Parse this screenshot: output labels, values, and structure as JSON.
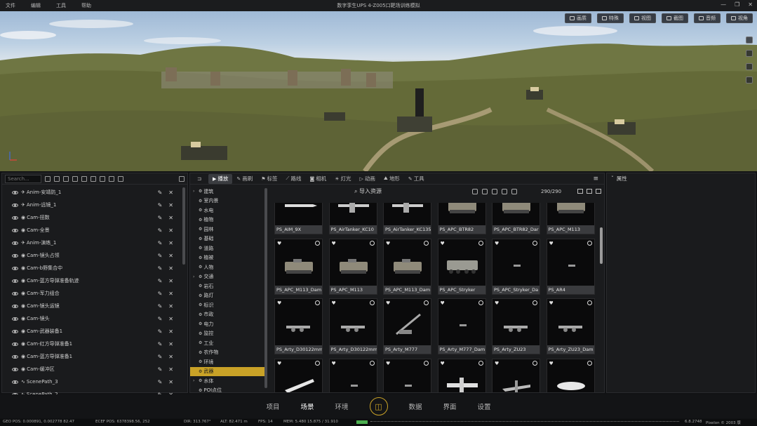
{
  "titlebar": {
    "menu": [
      "文件",
      "编辑",
      "工具",
      "帮助"
    ],
    "title": "数字孪生UPS 4-Z005口靶场训练模拟",
    "controls": [
      "—",
      "❐",
      "✕"
    ]
  },
  "viewport": {
    "toolbar": [
      "画质",
      "特殊",
      "视图",
      "截图",
      "音频",
      "视角"
    ]
  },
  "scene_panel": {
    "search_placeholder": "Search...",
    "items": [
      {
        "icon": "anim",
        "label": "Anim-安靖防_1"
      },
      {
        "icon": "anim",
        "label": "Anim-远镜_1"
      },
      {
        "icon": "cam",
        "label": "Cam-扭数"
      },
      {
        "icon": "cam",
        "label": "Cam-全景"
      },
      {
        "icon": "anim",
        "label": "Anim-演练_1"
      },
      {
        "icon": "cam",
        "label": "Cam-镜头占领"
      },
      {
        "icon": "cam",
        "label": "Cam-b野集合中"
      },
      {
        "icon": "cam",
        "label": "Cam-蓝方导弹准备轨迹"
      },
      {
        "icon": "cam",
        "label": "Cam-军力组合"
      },
      {
        "icon": "cam",
        "label": "Cam-镜头运镜"
      },
      {
        "icon": "cam",
        "label": "Cam-镜头"
      },
      {
        "icon": "cam",
        "label": "Cam-武器装备1"
      },
      {
        "icon": "cam",
        "label": "Cam-红方导弹准备1"
      },
      {
        "icon": "cam",
        "label": "Cam-蓝方导弹准备1"
      },
      {
        "icon": "cam",
        "label": "Cam-缓冲区"
      },
      {
        "icon": "path",
        "label": "ScenePath_3"
      },
      {
        "icon": "path",
        "label": "ScenePath_2"
      }
    ]
  },
  "asset_panel": {
    "tabs": [
      {
        "label": "播放",
        "active": true
      },
      {
        "label": "画刷",
        "active": false
      },
      {
        "label": "标签",
        "active": false
      },
      {
        "label": "路线",
        "active": false
      },
      {
        "label": "相机",
        "active": false
      },
      {
        "label": "灯光",
        "active": false
      },
      {
        "label": "动画",
        "active": false
      },
      {
        "label": "地形",
        "active": false
      },
      {
        "label": "工具",
        "active": false
      }
    ],
    "tree": [
      {
        "label": "建筑",
        "expand": true,
        "selected": false
      },
      {
        "label": "室内景",
        "expand": false,
        "selected": false
      },
      {
        "label": "水电",
        "expand": false,
        "selected": false
      },
      {
        "label": "植物",
        "expand": false,
        "selected": false
      },
      {
        "label": "园林",
        "expand": false,
        "selected": false
      },
      {
        "label": "基础",
        "expand": false,
        "selected": false
      },
      {
        "label": "道路",
        "expand": false,
        "selected": false
      },
      {
        "label": "植被",
        "expand": false,
        "selected": false
      },
      {
        "label": "人物",
        "expand": false,
        "selected": false
      },
      {
        "label": "交通",
        "expand": true,
        "selected": false
      },
      {
        "label": "岩石",
        "expand": false,
        "selected": false
      },
      {
        "label": "路灯",
        "expand": false,
        "selected": false
      },
      {
        "label": "标识",
        "expand": false,
        "selected": false
      },
      {
        "label": "市政",
        "expand": false,
        "selected": false
      },
      {
        "label": "电力",
        "expand": false,
        "selected": false
      },
      {
        "label": "监控",
        "expand": false,
        "selected": false
      },
      {
        "label": "工业",
        "expand": false,
        "selected": false
      },
      {
        "label": "农作物",
        "expand": false,
        "selected": false
      },
      {
        "label": "环境",
        "expand": false,
        "selected": false
      },
      {
        "label": "武器",
        "expand": false,
        "selected": true
      },
      {
        "label": "水体",
        "expand": true,
        "selected": false
      },
      {
        "label": "POI点位",
        "expand": false,
        "selected": false
      }
    ],
    "import_label": "导入资源",
    "count": "290/290",
    "assets": [
      {
        "label": "PS_AIM_9X",
        "shape": "missile"
      },
      {
        "label": "PS_AirTanker_KC10",
        "shape": "plane"
      },
      {
        "label": "PS_AirTanker_KC135",
        "shape": "plane"
      },
      {
        "label": "PS_APC_BTR82",
        "shape": "apc"
      },
      {
        "label": "PS_APC_BTR82_Dar",
        "shape": "apc"
      },
      {
        "label": "PS_APC_M113",
        "shape": "apc"
      },
      {
        "label": "PS_APC_M113_Dam",
        "shape": "apc"
      },
      {
        "label": "PS_APC_M113",
        "shape": "apc"
      },
      {
        "label": "PS_APC_M113_Dam",
        "shape": "apc"
      },
      {
        "label": "PS_APC_Stryker",
        "shape": "apc8"
      },
      {
        "label": "PS_APC_Stryker_Da",
        "shape": "small"
      },
      {
        "label": "PS_AR4",
        "shape": "small"
      },
      {
        "label": "PS_Arty_D30122mm",
        "shape": "gun"
      },
      {
        "label": "PS_Arty_D30122mm",
        "shape": "gun"
      },
      {
        "label": "PS_Arty_M777",
        "shape": "gun2"
      },
      {
        "label": "PS_Arty_M777_Dam",
        "shape": "small"
      },
      {
        "label": "PS_Arty_ZU23",
        "shape": "gun"
      },
      {
        "label": "PS_Arty_ZU23_Dam",
        "shape": "gun"
      },
      {
        "label": "",
        "shape": "missile2"
      },
      {
        "label": "",
        "shape": "small"
      },
      {
        "label": "",
        "shape": "small"
      },
      {
        "label": "",
        "shape": "a10"
      },
      {
        "label": "",
        "shape": "jet"
      },
      {
        "label": "",
        "shape": "bomb"
      }
    ]
  },
  "properties_panel": {
    "title": "属性"
  },
  "bottom_nav": {
    "items": [
      {
        "label": "项目",
        "active": false
      },
      {
        "label": "场景",
        "active": true
      },
      {
        "label": "环境",
        "active": false
      },
      {
        "label": "数据",
        "active": false
      },
      {
        "label": "界面",
        "active": false
      },
      {
        "label": "设置",
        "active": false
      }
    ]
  },
  "statusbar": {
    "geo": "GEO POS: 0.000891, 0.002778 82.47",
    "ecef": "ECEF POS: 6378398.56, 252",
    "dir": "DIR: 313.767°",
    "alt": "ALT: 82.471 m",
    "fps": "FPS: 14",
    "mem": "MEM: 5.480 15.875 / 31.910",
    "version": "6.8.2748",
    "copyright": "Pixelon © 2003 版"
  },
  "colors": {
    "accent": "#c9a227",
    "panel_bg": "#1a1b1d",
    "mem_bar": "#4caf50"
  }
}
